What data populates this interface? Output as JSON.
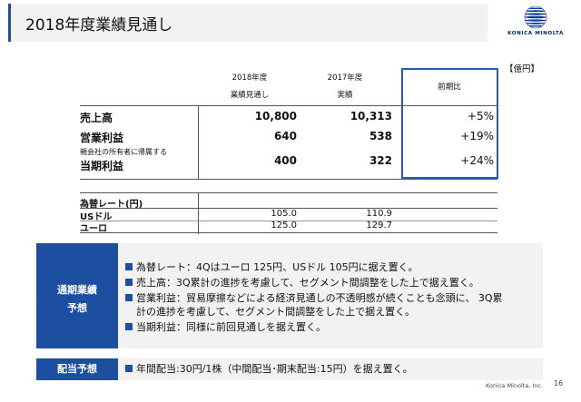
{
  "header": {
    "title": "2018年度業績見通し"
  },
  "logo": {
    "brand": "KONICA MINOLTA"
  },
  "table": {
    "unit": "【億円】",
    "col1_line1": "2018年度",
    "col1_line2": "業績見通し",
    "col2_line1": "2017年度",
    "col2_line2": "実績",
    "col3": "前期比",
    "rows": [
      {
        "label": "売上高",
        "sublabel": "",
        "v2018": "10,800",
        "v2017": "10,313",
        "yoy": "+5%"
      },
      {
        "label": "営業利益",
        "sublabel": "",
        "v2018": "640",
        "v2017": "538",
        "yoy": "+19%"
      },
      {
        "label": "当期利益",
        "sublabel": "親会社の所有者に帰属する",
        "v2018": "400",
        "v2017": "322",
        "yoy": "+24%"
      }
    ],
    "fx": {
      "heading": "為替レート(円)",
      "rows": [
        {
          "label": "USドル",
          "v2018": "105.0",
          "v2017": "110.9"
        },
        {
          "label": "ユーロ",
          "v2018": "125.0",
          "v2017": "129.7"
        }
      ]
    }
  },
  "forecast": {
    "label_line1": "通期業績",
    "label_line2": "予想",
    "bullets": [
      "為替レート：4Qはユーロ 125円、USドル 105円に据え置く。",
      "売上高：3Q累計の進捗を考慮して、セグメント間調整をした上で据え置く。",
      "営業利益：貿易摩擦などによる経済見通しの不透明感が続くことも念頭に、 3Q累",
      "計の進捗を考慮して、セグメント間調整をした上で据え置く。",
      "当期利益：同様に前回見通しを据え置く。"
    ]
  },
  "dividend": {
    "label": "配当予想",
    "text": "年間配当:30円/1株（中間配当･期末配当:15円）を据え置く。"
  },
  "footer": {
    "company": "Konica Minolta, Inc.",
    "page": "16"
  },
  "colors": {
    "brand_blue": "#1c4fa0",
    "box_blue": "#1f5fb4",
    "panel_gray": "#f2f2f2"
  }
}
